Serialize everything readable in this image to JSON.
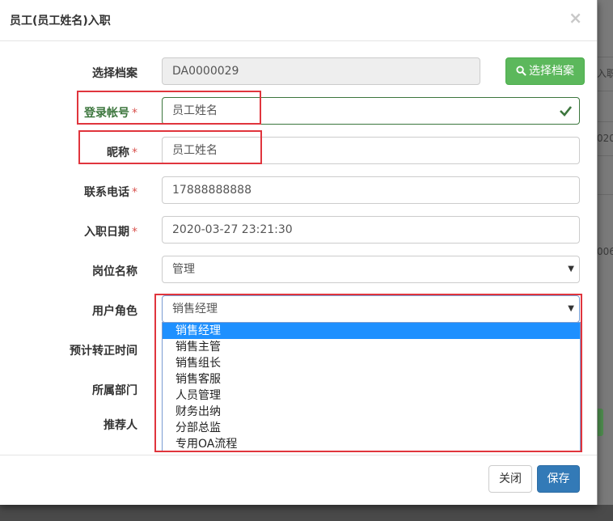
{
  "background_page": {
    "fragments": [
      "入职",
      "020",
      "006"
    ]
  },
  "modal": {
    "title": "员工(员工姓名)入职",
    "close_glyph": "×"
  },
  "form": {
    "archive": {
      "label": "选择档案",
      "value": "DA0000029",
      "button": "选择档案"
    },
    "account": {
      "label": "登录帐号",
      "required": "*",
      "value": "员工姓名"
    },
    "nickname": {
      "label": "昵称",
      "required": "*",
      "value": "员工姓名"
    },
    "phone": {
      "label": "联系电话",
      "required": "*",
      "value": "17888888888"
    },
    "hire_date": {
      "label": "入职日期",
      "required": "*",
      "value": "2020-03-27 23:21:30"
    },
    "position": {
      "label": "岗位名称",
      "value": "管理"
    },
    "role": {
      "label": "用户角色",
      "value": "销售经理",
      "options": [
        "销售经理",
        "销售主管",
        "销售组长",
        "销售客服",
        "人员管理",
        "财务出纳",
        "分部总监",
        "专用OA流程"
      ],
      "selected_index": 0
    },
    "probation_end": {
      "label": "预计转正时间"
    },
    "department": {
      "label": "所属部门"
    },
    "referrer": {
      "label": "推荐人"
    }
  },
  "footer": {
    "close_label": "关闭",
    "save_label": "保存"
  },
  "colors": {
    "primary": "#337ab7",
    "success": "#5cb85c",
    "success_text": "#3c763d",
    "required": "#d9534f",
    "annotation_red": "#e0353d",
    "selected_option": "#1e90ff"
  },
  "icons": {
    "search": "search-icon",
    "check": "check-icon",
    "caret": "caret-down-icon",
    "close": "close-icon"
  }
}
